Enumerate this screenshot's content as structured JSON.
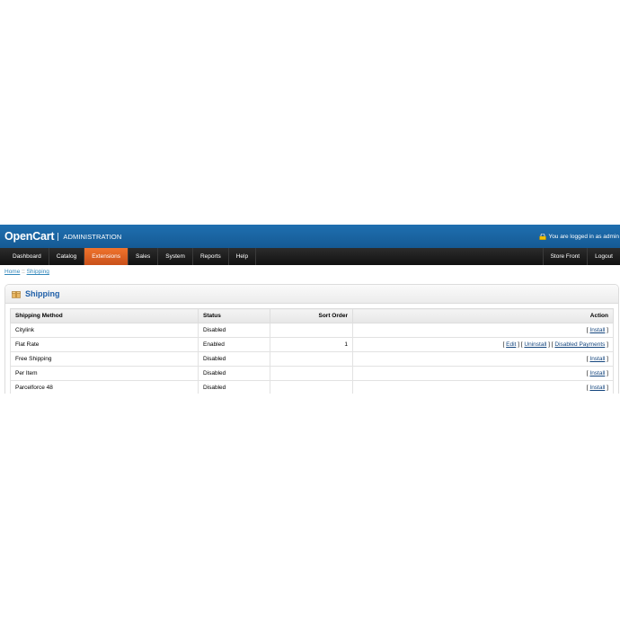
{
  "header": {
    "logo": "OpenCart",
    "subtitle": "ADMINISTRATION",
    "login_text": "You are logged in as admin"
  },
  "menu": {
    "left": [
      "Dashboard",
      "Catalog",
      "Extensions",
      "Sales",
      "System",
      "Reports",
      "Help"
    ],
    "right": [
      "Store Front",
      "Logout"
    ],
    "active": "Extensions"
  },
  "breadcrumb": {
    "home": "Home",
    "separator": "::",
    "current": "Shipping"
  },
  "box": {
    "title": "Shipping"
  },
  "table": {
    "columns": [
      "Shipping Method",
      "Status",
      "Sort Order",
      "Action"
    ],
    "rows": [
      {
        "method": "Citylink",
        "status": "Disabled",
        "sort": "",
        "actions": [
          "Install"
        ]
      },
      {
        "method": "Flat Rate",
        "status": "Enabled",
        "sort": "1",
        "actions": [
          "Edit",
          "Uninstall",
          "Disabled Payments"
        ]
      },
      {
        "method": "Free Shipping",
        "status": "Disabled",
        "sort": "",
        "actions": [
          "Install"
        ]
      },
      {
        "method": "Per Item",
        "status": "Disabled",
        "sort": "",
        "actions": [
          "Install"
        ]
      },
      {
        "method": "Parcelforce 48",
        "status": "Disabled",
        "sort": "",
        "actions": [
          "Install"
        ]
      }
    ]
  },
  "colors": {
    "header": "#1a65a3",
    "menu": "#1c1c1c",
    "active_tab": "#e0622a",
    "title": "#1f5fa8",
    "link": "#15467e"
  }
}
